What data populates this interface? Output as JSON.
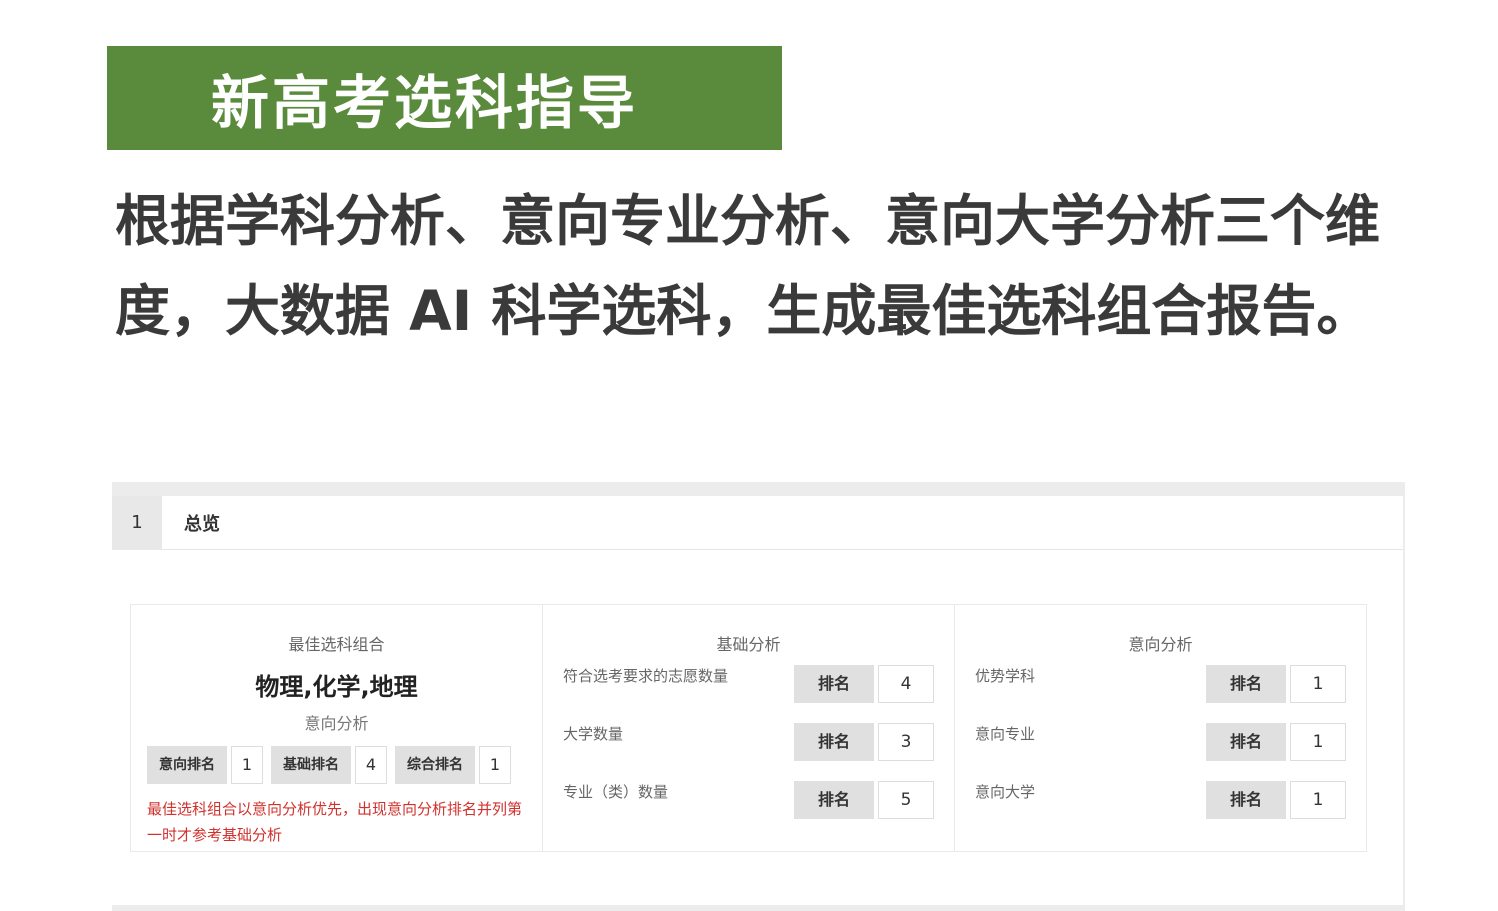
{
  "banner": {
    "title": "新高考选科指导"
  },
  "intro": {
    "text": "根据学科分析、意向专业分析、意向大学分析三个维度，大数据 AI 科学选科，生成最佳选科组合报告。"
  },
  "tab": {
    "number": "1",
    "label": "总览"
  },
  "best": {
    "title": "最佳选科组合",
    "combo": "物理,化学,地理",
    "subtitle": "意向分析",
    "ranks": [
      {
        "label": "意向排名",
        "value": "1"
      },
      {
        "label": "基础排名",
        "value": "4"
      },
      {
        "label": "综合排名",
        "value": "1"
      }
    ],
    "note": "最佳选科组合以意向分析优先，出现意向分析排名并列第一时才参考基础分析"
  },
  "basic": {
    "title": "基础分析",
    "rows": [
      {
        "label": "符合选考要求的志愿数量",
        "rank_label": "排名",
        "value": "4"
      },
      {
        "label": "大学数量",
        "rank_label": "排名",
        "value": "3"
      },
      {
        "label": "专业（类）数量",
        "rank_label": "排名",
        "value": "5"
      }
    ]
  },
  "intent": {
    "title": "意向分析",
    "rows": [
      {
        "label": "优势学科",
        "rank_label": "排名",
        "value": "1"
      },
      {
        "label": "意向专业",
        "rank_label": "排名",
        "value": "1"
      },
      {
        "label": "意向大学",
        "rank_label": "排名",
        "value": "1"
      }
    ]
  },
  "colors": {
    "banner": "#5a8a3c",
    "note": "#d0312d"
  }
}
